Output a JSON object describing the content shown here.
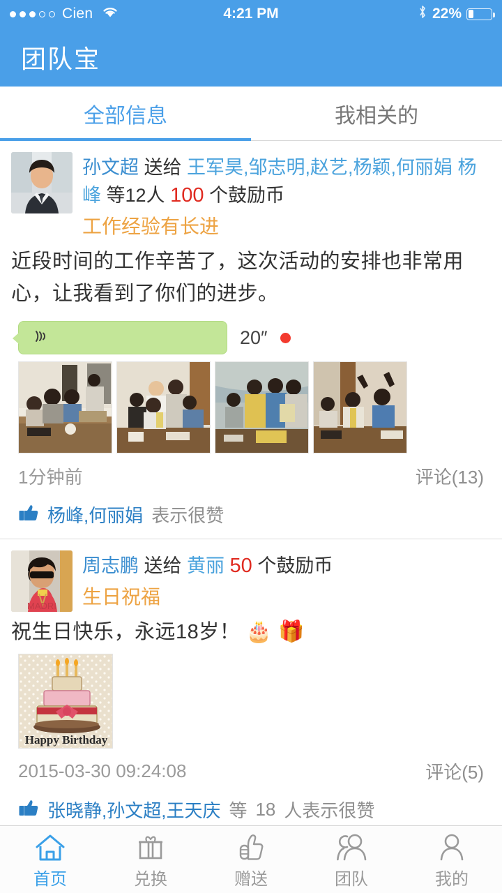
{
  "status_bar": {
    "carrier": "Cien",
    "signal_dots_filled": 3,
    "signal_dots_total": 5,
    "wifi_icon": "wifi-icon",
    "time": "4:21 PM",
    "bluetooth_icon": "bluetooth-icon",
    "battery_percent": "22%",
    "battery_level": 22
  },
  "header": {
    "title": "团队宝",
    "background_color": "#4a9fe8"
  },
  "tabs": {
    "active_index": 0,
    "items": [
      {
        "label": "全部信息"
      },
      {
        "label": "我相关的"
      }
    ],
    "active_color": "#4a9fe8",
    "inactive_color": "#777777"
  },
  "feed": {
    "posts": [
      {
        "avatar_name": "avatar-sun-wenchao",
        "sender": "孙文超",
        "action": "送给",
        "recipients": "王军昊,邹志明,赵艺,杨颖,何丽娟 杨峰",
        "others": "等12人",
        "amount": "100",
        "unit": "个鼓励币",
        "subject": "工作经验有长进",
        "body": "近段时间的工作辛苦了，这次活动的安排也非常用心，让我看到了你们的进步。",
        "voice": {
          "duration": "20″",
          "unread": true
        },
        "photos": [
          {
            "name": "photo-meeting-1"
          },
          {
            "name": "photo-meeting-2"
          },
          {
            "name": "photo-meeting-3"
          },
          {
            "name": "photo-meeting-4"
          }
        ],
        "timestamp": "1分钟前",
        "comments": "评论(13)",
        "like_icon": "thumbs-up-icon",
        "like_names": "杨峰,何丽娟",
        "like_suffix": "表示很赞"
      },
      {
        "avatar_name": "avatar-zhou-zhipeng",
        "sender": "周志鹏",
        "action": "送给",
        "recipients": "黄丽",
        "amount": "50",
        "unit": "个鼓励币",
        "subject": "生日祝福",
        "body": "祝生日快乐，永远18岁！",
        "body_emoji": [
          "🎂",
          "🎁"
        ],
        "image": {
          "name": "photo-happy-birthday-cake",
          "caption": "Happy Birthday"
        },
        "timestamp": "2015-03-30 09:24:08",
        "comments": "评论(5)",
        "like_icon": "thumbs-up-icon",
        "like_names": "张晓静,孙文超,王天庆",
        "like_mid": "等",
        "like_count": "18",
        "like_suffix": "人表示很赞"
      }
    ]
  },
  "tabbar": {
    "active_index": 0,
    "items": [
      {
        "label": "首页",
        "icon": "home-icon"
      },
      {
        "label": "兑换",
        "icon": "gift-icon"
      },
      {
        "label": "赠送",
        "icon": "thumbs-up-icon"
      },
      {
        "label": "团队",
        "icon": "people-icon"
      },
      {
        "label": "我的",
        "icon": "person-icon"
      }
    ],
    "active_color": "#3aa0e8",
    "inactive_color": "#9a9a9a"
  }
}
